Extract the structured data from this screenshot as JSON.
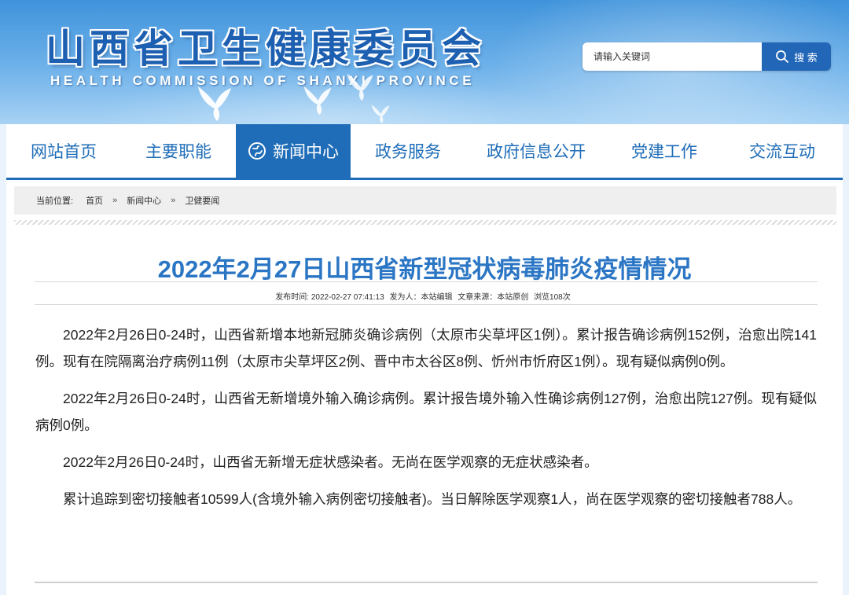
{
  "header": {
    "title": "山西省卫生健康委员会",
    "subtitle": "HEALTH COMMISSION OF SHANXI PROVINCE",
    "search": {
      "placeholder": "请输入关键词",
      "button_label": "搜 索"
    }
  },
  "nav": {
    "items": [
      {
        "label": "网站首页",
        "active": false
      },
      {
        "label": "主要职能",
        "active": false
      },
      {
        "label": "新闻中心",
        "active": true,
        "icon": "globe-icon"
      },
      {
        "label": "政务服务",
        "active": false
      },
      {
        "label": "政府信息公开",
        "active": false
      },
      {
        "label": "党建工作",
        "active": false
      },
      {
        "label": "交流互动",
        "active": false
      }
    ]
  },
  "breadcrumb": {
    "label": "当前位置:",
    "items": [
      "首页",
      "新闻中心",
      "卫健要闻"
    ],
    "separator": "»"
  },
  "article": {
    "title": "2022年2月27日山西省新型冠状病毒肺炎疫情情况",
    "meta": {
      "publish_time": "发布时间: 2022-02-27 07:41:13",
      "publisher": "发为人：本站编辑",
      "source": "文章来源：本站原创",
      "views": "浏览108次"
    },
    "paragraphs": [
      "2022年2月26日0-24时，山西省新增本地新冠肺炎确诊病例（太原市尖草坪区1例）。累计报告确诊病例152例，治愈出院141例。现有在院隔离治疗病例11例（太原市尖草坪区2例、晋中市太谷区8例、忻州市忻府区1例）。现有疑似病例0例。",
      "2022年2月26日0-24时，山西省无新增境外输入确诊病例。累计报告境外输入性确诊病例127例，治愈出院127例。现有疑似病例0例。",
      "2022年2月26日0-24时，山西省无新增无症状感染者。无尚在医学观察的无症状感染者。",
      "累计追踪到密切接触者10599人(含境外输入病例密切接触者)。当日解除医学观察1人，尚在医学观察的密切接触者788人。"
    ]
  },
  "colors": {
    "brand_blue": "#1f6db8",
    "title_blue": "#2b76c4",
    "search_button": "#2266b8"
  }
}
